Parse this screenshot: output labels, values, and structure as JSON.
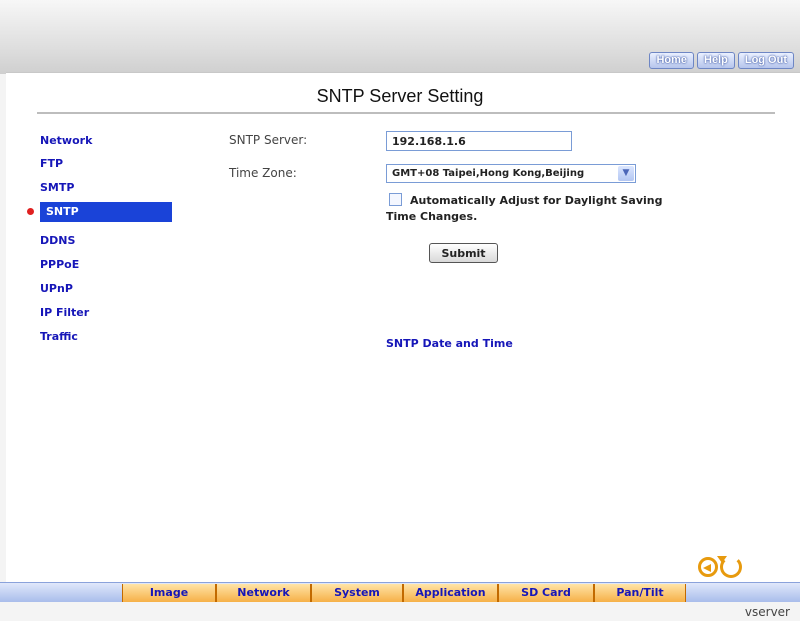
{
  "top_nav": {
    "home": "Home",
    "help": "Help",
    "logout": "Log Out"
  },
  "page": {
    "title": "SNTP Server Setting"
  },
  "sidebar": {
    "items": [
      {
        "label": "Network"
      },
      {
        "label": "FTP"
      },
      {
        "label": "SMTP"
      },
      {
        "label": "SNTP",
        "active": true
      },
      {
        "label": "DDNS"
      },
      {
        "label": "PPPoE"
      },
      {
        "label": "UPnP"
      },
      {
        "label": "IP Filter"
      },
      {
        "label": "Traffic"
      }
    ]
  },
  "form": {
    "server_label": "SNTP Server:",
    "server_value": "192.168.1.6",
    "timezone_label": "Time Zone:",
    "timezone_value": "GMT+08 Taipei,Hong Kong,Beijing",
    "daylight_label": "Automatically Adjust for Daylight Saving Time Changes.",
    "daylight_checked": false,
    "submit_label": "Submit"
  },
  "section": {
    "date_time_link": "SNTP Date and Time"
  },
  "bottom_tabs": [
    {
      "label": "Image"
    },
    {
      "label": "Network"
    },
    {
      "label": "System"
    },
    {
      "label": "Application"
    },
    {
      "label": "SD Card"
    },
    {
      "label": "Pan/Tilt"
    }
  ],
  "footer": {
    "brand": "vserver"
  },
  "colors": {
    "nav_link": "#1616b8",
    "active_nav": "#1a43d8",
    "tab_fill": "#f6b048",
    "icon_orange": "#e79a0e"
  },
  "icons": [
    "back-arrow-icon",
    "refresh-icon",
    "chevron-down-icon",
    "red-bullet-icon"
  ]
}
